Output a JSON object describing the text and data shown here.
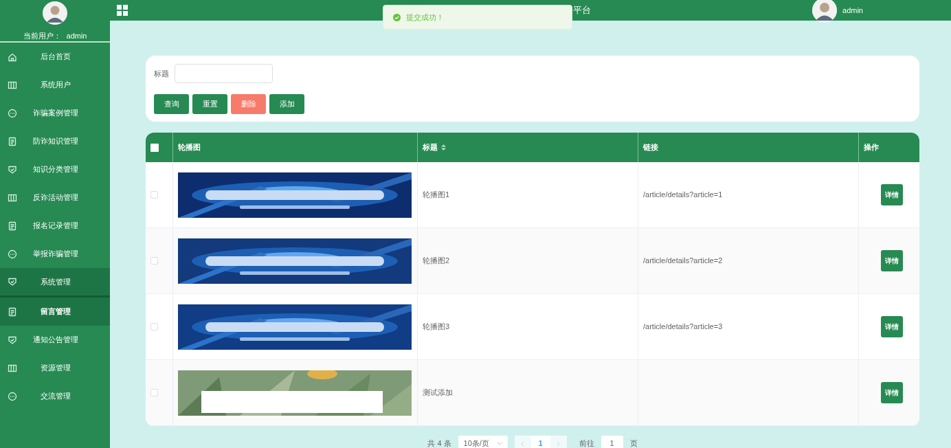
{
  "sidebar": {
    "current_user_label": "当前用户：",
    "current_user": "admin",
    "items": [
      {
        "label": "后台首页",
        "kind": "home",
        "selected": false,
        "expanded": false
      },
      {
        "label": "系统用户",
        "kind": "columns",
        "selected": false,
        "expanded": false
      },
      {
        "label": "诈骗案例管理",
        "kind": "chat",
        "selected": false,
        "expanded": false
      },
      {
        "label": "防诈知识管理",
        "kind": "doc",
        "selected": false,
        "expanded": false
      },
      {
        "label": "知识分类管理",
        "kind": "shield",
        "selected": false,
        "expanded": false
      },
      {
        "label": "反诈活动管理",
        "kind": "columns",
        "selected": false,
        "expanded": false
      },
      {
        "label": "报名记录管理",
        "kind": "doc",
        "selected": false,
        "expanded": false
      },
      {
        "label": "举报诈骗管理",
        "kind": "chat",
        "selected": false,
        "expanded": false
      },
      {
        "label": "系统管理",
        "kind": "shield",
        "selected": false,
        "expanded": true
      },
      {
        "label": "留言管理",
        "kind": "doc",
        "selected": true,
        "expanded": false
      },
      {
        "label": "通知公告管理",
        "kind": "shield",
        "selected": false,
        "expanded": false
      },
      {
        "label": "资源管理",
        "kind": "columns",
        "selected": false,
        "expanded": false
      },
      {
        "label": "交流管理",
        "kind": "chat",
        "selected": false,
        "expanded": false
      }
    ]
  },
  "header": {
    "title_visible": "平台",
    "user": "admin"
  },
  "toast": {
    "message": "提交成功！"
  },
  "search": {
    "label": "标题",
    "buttons": [
      {
        "label": "查询",
        "kind": "primary"
      },
      {
        "label": "重置",
        "kind": "primary"
      },
      {
        "label": "删除",
        "kind": "danger"
      },
      {
        "label": "添加",
        "kind": "primary"
      }
    ]
  },
  "table": {
    "columns": [
      {
        "label": "轮播图",
        "sortable": false
      },
      {
        "label": "标题",
        "sortable": true
      },
      {
        "label": "链接",
        "sortable": false
      },
      {
        "label": "操作",
        "sortable": false
      }
    ],
    "all_checked": false,
    "rows": [
      {
        "checked": false,
        "title": "轮播图1",
        "link": "/article/details?article=1",
        "action": "详情"
      },
      {
        "checked": false,
        "title": "轮播图2",
        "link": "/article/details?article=2",
        "action": "详情"
      },
      {
        "checked": false,
        "title": "轮播图3",
        "link": "/article/details?article=3",
        "action": "详情"
      },
      {
        "checked": false,
        "title": "测试添加",
        "action": "详情"
      }
    ]
  },
  "pagination": {
    "total": "共 4 条",
    "page_size": "10条/页",
    "pages": [
      {
        "label": "1",
        "selected": true
      }
    ],
    "goto_label": "前往",
    "goto_value": "1",
    "page_suffix": "页"
  }
}
